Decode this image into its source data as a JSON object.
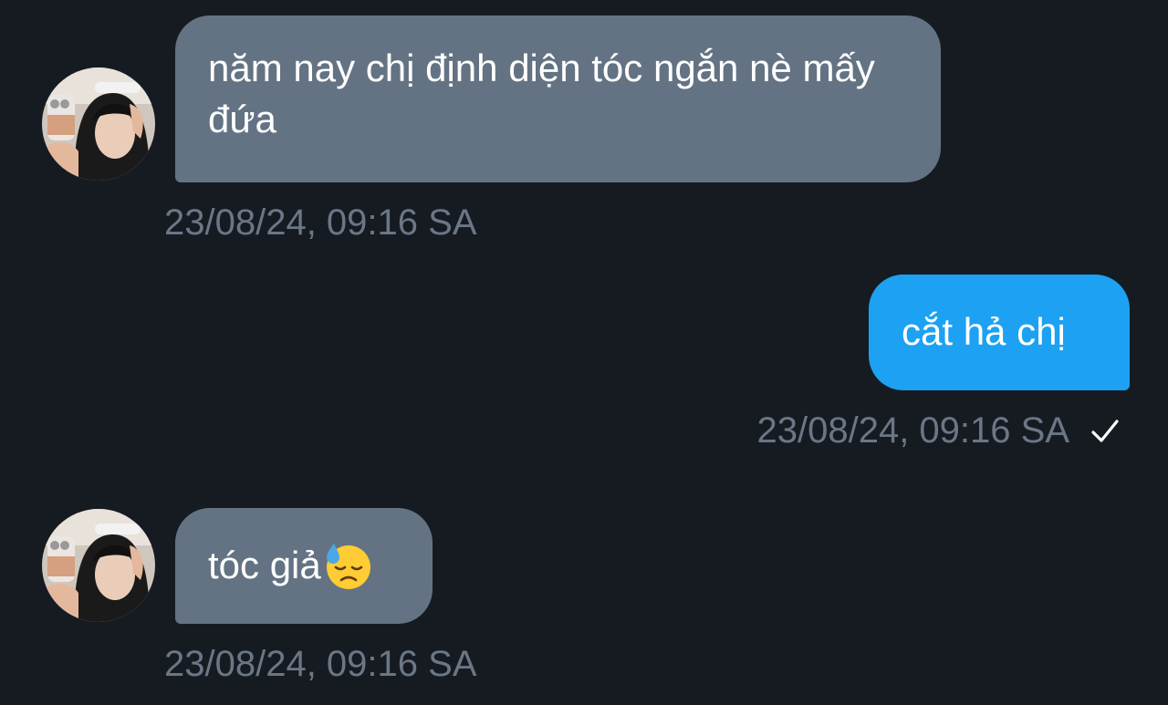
{
  "messages": [
    {
      "direction": "incoming",
      "text": "năm nay chị định diện tóc ngắn nè mấy đứa",
      "timestamp": "23/08/24, 09:16 SA"
    },
    {
      "direction": "outgoing",
      "text": "cắt hả chị",
      "timestamp": "23/08/24, 09:16 SA",
      "status_icon": "check-icon"
    },
    {
      "direction": "incoming",
      "text": "tóc giả",
      "emoji": "downcast-face-with-sweat-icon",
      "timestamp": "23/08/24, 09:16 SA"
    }
  ],
  "colors": {
    "background": "#161b22",
    "incoming_bubble": "#647383",
    "outgoing_bubble": "#1da1f2",
    "timestamp": "#6b7785",
    "text": "#ffffff"
  }
}
